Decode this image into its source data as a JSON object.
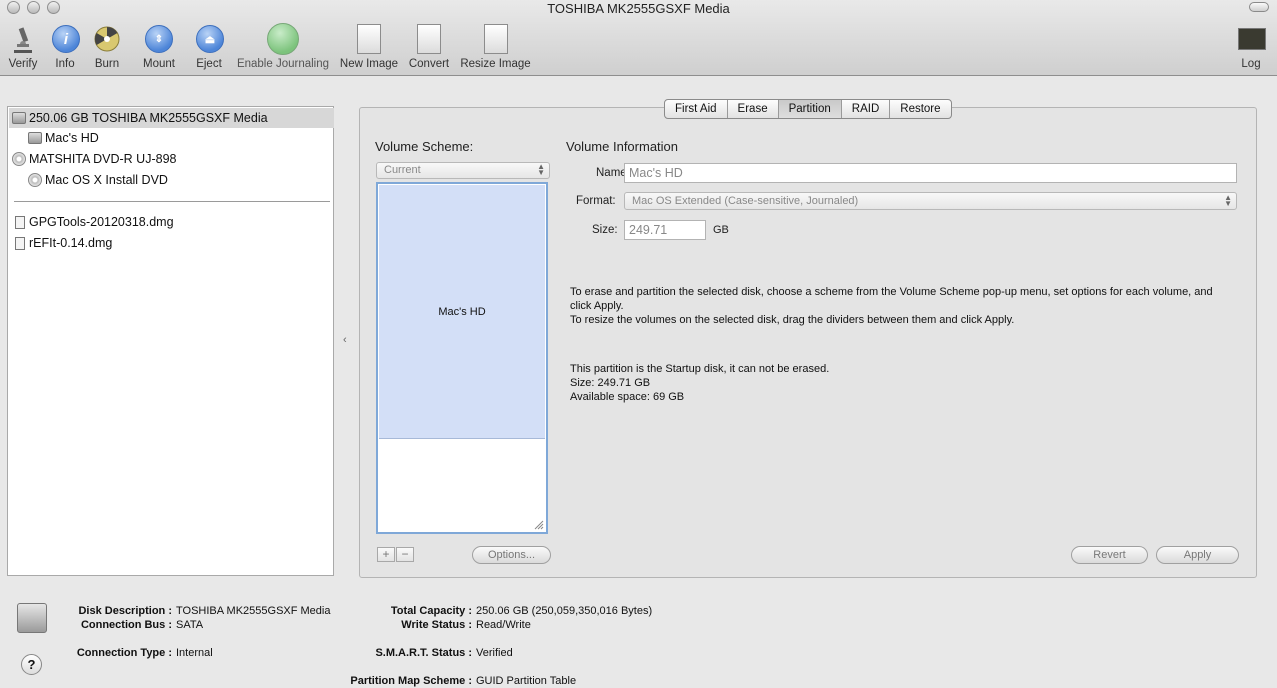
{
  "window": {
    "title": "TOSHIBA MK2555GSXF Media"
  },
  "toolbar": {
    "verify": "Verify",
    "info": "Info",
    "burn": "Burn",
    "mount": "Mount",
    "eject": "Eject",
    "enable_journaling": "Enable Journaling",
    "new_image": "New Image",
    "convert": "Convert",
    "resize_image": "Resize Image",
    "log": "Log"
  },
  "sidebar": {
    "items": [
      {
        "label": "250.06 GB TOSHIBA MK2555GSXF Media"
      },
      {
        "label": "Mac's HD"
      },
      {
        "label": "MATSHITA DVD-R UJ-898"
      },
      {
        "label": "Mac OS X Install DVD"
      },
      {
        "label": "GPGTools-20120318.dmg"
      },
      {
        "label": "rEFIt-0.14.dmg"
      }
    ]
  },
  "tabs": [
    "First Aid",
    "Erase",
    "Partition",
    "RAID",
    "Restore"
  ],
  "partition": {
    "volume_scheme_label": "Volume Scheme:",
    "volume_scheme_value": "Current",
    "volume_info_title": "Volume Information",
    "name_label": "Name:",
    "name_value": "Mac's HD",
    "format_label": "Format:",
    "format_value": "Mac OS Extended (Case-sensitive, Journaled)",
    "size_label": "Size:",
    "size_value": "249.71",
    "size_unit": "GB",
    "partition_label": "Mac's HD",
    "help1": "To erase and partition the selected disk, choose a scheme from the Volume Scheme pop-up menu, set options for each volume, and click Apply.",
    "help2": "To resize the volumes on the selected disk, drag the dividers between them and click Apply.",
    "startup_note": "This partition is the Startup disk, it can not be erased.",
    "size_line": "Size: 249.71 GB",
    "available_line": "Available space: 69 GB",
    "options_button": "Options...",
    "revert_button": "Revert",
    "apply_button": "Apply",
    "add_symbol": "+",
    "remove_symbol": "−"
  },
  "disk_info": {
    "left": [
      {
        "key": "Disk Description :",
        "value": "TOSHIBA MK2555GSXF Media"
      },
      {
        "key": "Connection Bus :",
        "value": "SATA"
      },
      {
        "key": "Connection Type :",
        "value": "Internal"
      }
    ],
    "right": [
      {
        "key": "Total Capacity :",
        "value": "250.06 GB (250,059,350,016 Bytes)"
      },
      {
        "key": "Write Status :",
        "value": "Read/Write"
      },
      {
        "key": "S.M.A.R.T. Status :",
        "value": "Verified"
      },
      {
        "key": "Partition Map Scheme :",
        "value": "GUID Partition Table"
      }
    ]
  },
  "help_symbol": "?",
  "collapse_symbol": "‹"
}
